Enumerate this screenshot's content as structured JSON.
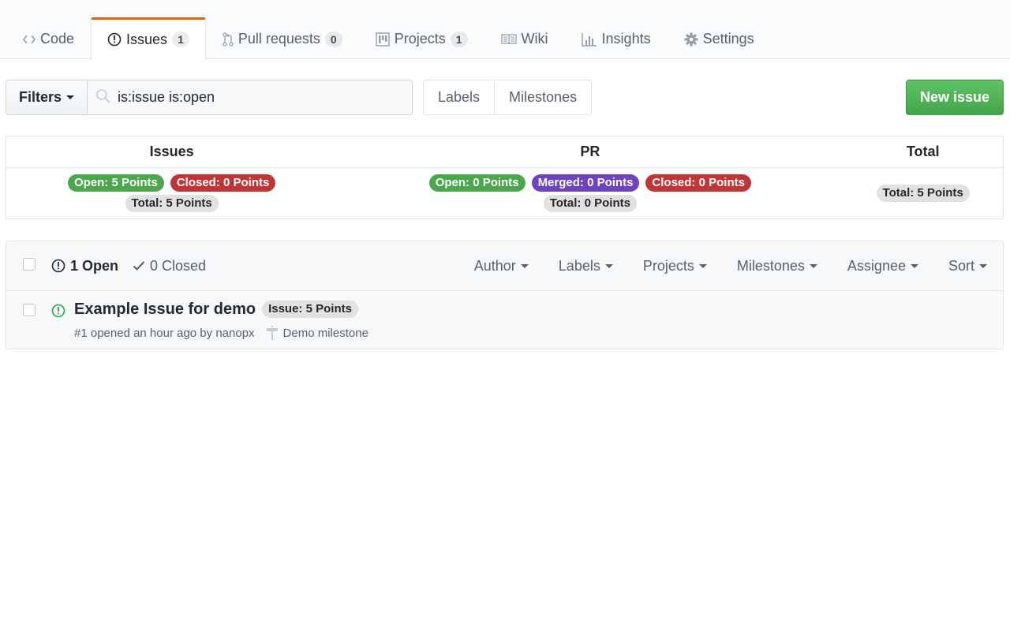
{
  "tabs": [
    {
      "label": "Code",
      "icon": "code-icon"
    },
    {
      "label": "Issues",
      "icon": "issue-opened-icon",
      "count": "1",
      "selected": true
    },
    {
      "label": "Pull requests",
      "icon": "git-pull-request-icon",
      "count": "0"
    },
    {
      "label": "Projects",
      "icon": "project-icon",
      "count": "1"
    },
    {
      "label": "Wiki",
      "icon": "book-icon"
    },
    {
      "label": "Insights",
      "icon": "graph-icon"
    },
    {
      "label": "Settings",
      "icon": "gear-icon"
    }
  ],
  "subnav": {
    "filters_label": "Filters",
    "search_value": "is:issue is:open",
    "labels_label": "Labels",
    "milestones_label": "Milestones",
    "new_issue_label": "New issue"
  },
  "points": {
    "headers": {
      "issues": "Issues",
      "pr": "PR",
      "total": "Total"
    },
    "issues": {
      "open": "Open: 5 Points",
      "closed": "Closed: 0 Points",
      "total": "Total: 5 Points"
    },
    "pr": {
      "open": "Open: 0 Points",
      "merged": "Merged: 0 Points",
      "closed": "Closed: 0 Points",
      "total": "Total: 0 Points"
    },
    "total": "Total: 5 Points",
    "colors": {
      "open": "#4ca64e",
      "closed": "#c23535",
      "merged": "#6f42c1",
      "neutral": "#e1e1e1"
    }
  },
  "list": {
    "open_label": "1 Open",
    "closed_label": "0 Closed",
    "filters": [
      "Author",
      "Labels",
      "Projects",
      "Milestones",
      "Assignee",
      "Sort"
    ],
    "issues": [
      {
        "title": "Example Issue for demo",
        "label": "Issue: 5 Points",
        "meta": "#1 opened an hour ago by nanopx",
        "milestone": "Demo milestone"
      }
    ]
  },
  "accent": {
    "tab_active": "#e36209",
    "primary_button": "#43a549",
    "open_icon": "#28a745"
  }
}
